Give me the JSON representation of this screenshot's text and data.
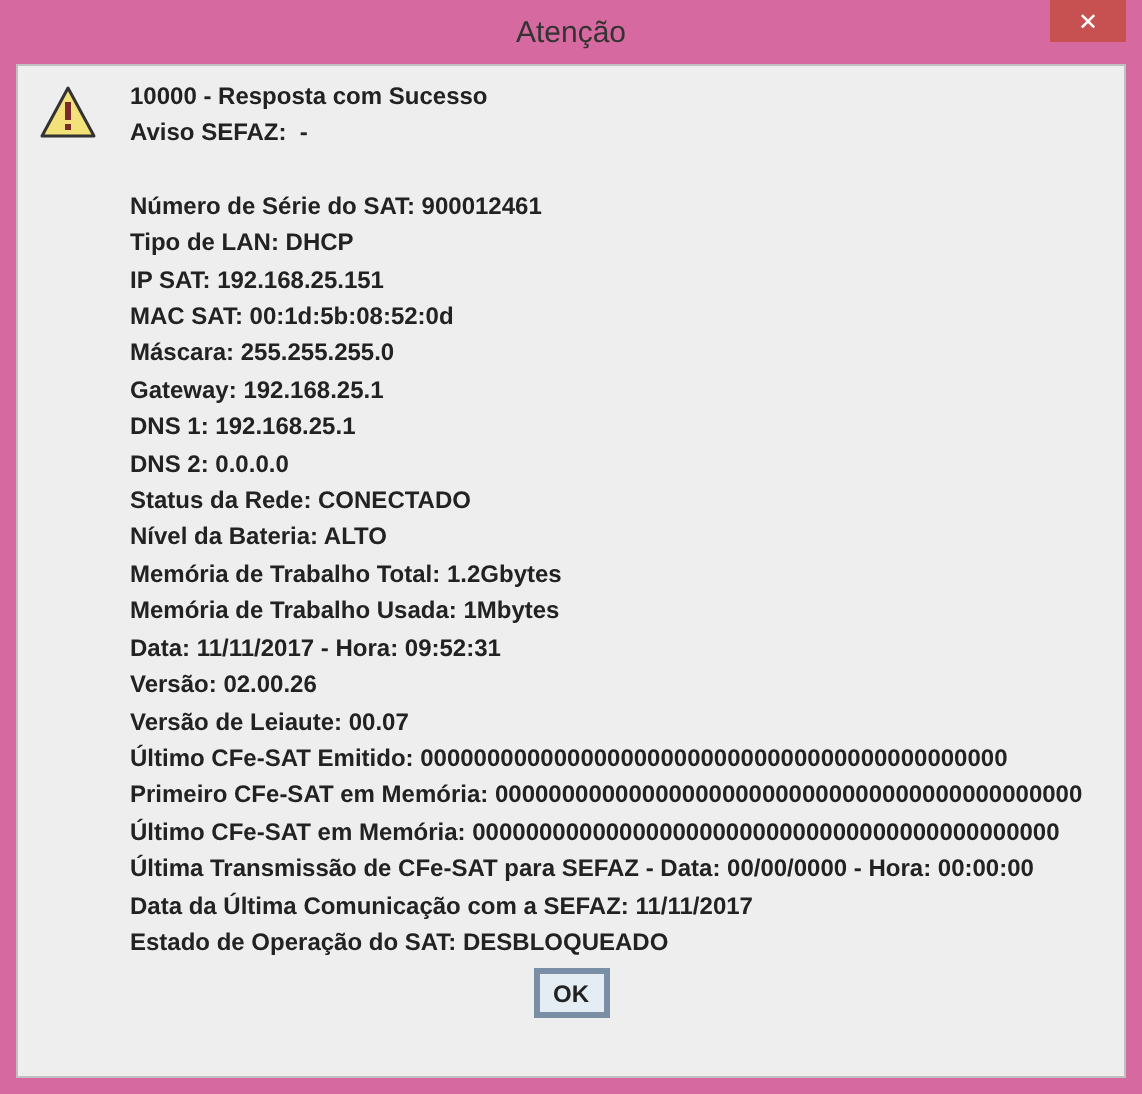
{
  "window": {
    "title": "Atenção",
    "close": "✕"
  },
  "message": {
    "header": [
      "10000 - Resposta com Sucesso",
      "Aviso SEFAZ:  -"
    ],
    "lines": [
      "Número de Série do SAT: 900012461",
      "Tipo de LAN: DHCP",
      "IP SAT: 192.168.25.151",
      "MAC SAT: 00:1d:5b:08:52:0d",
      "Máscara: 255.255.255.0",
      "Gateway: 192.168.25.1",
      "DNS 1: 192.168.25.1",
      "DNS 2: 0.0.0.0",
      "Status da Rede: CONECTADO",
      "Nível da Bateria: ALTO",
      "Memória de Trabalho Total: 1.2Gbytes",
      "Memória de Trabalho Usada: 1Mbytes",
      "Data: 11/11/2017 - Hora: 09:52:31",
      "Versão: 02.00.26",
      "Versão de Leiaute: 00.07",
      "Último CFe-SAT Emitido: 00000000000000000000000000000000000000000000",
      "Primeiro CFe-SAT em Memória: 00000000000000000000000000000000000000000000",
      "Último CFe-SAT em Memória: 00000000000000000000000000000000000000000000",
      "Última Transmissão de CFe-SAT para SEFAZ - Data: 00/00/0000 - Hora: 00:00:00",
      "Data da Última Comunicação com a SEFAZ: 11/11/2017",
      "Estado de Operação do SAT: DESBLOQUEADO"
    ]
  },
  "buttons": [
    "OK"
  ]
}
